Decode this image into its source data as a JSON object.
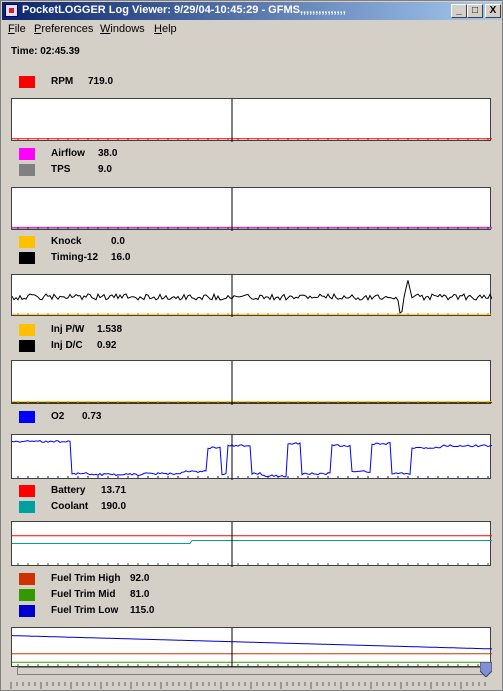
{
  "window": {
    "title": "PocketLOGGER Log Viewer: 9/29/04-10:45:29 - GFMS,,,,,,,,,,,,,,,",
    "minimize": "_",
    "maximize": "□",
    "close": "X"
  },
  "menu": [
    {
      "first": "F",
      "rest": "ile"
    },
    {
      "first": "P",
      "rest": "references"
    },
    {
      "first": "W",
      "rest": "indows"
    },
    {
      "first": "H",
      "rest": "elp"
    }
  ],
  "time": "Time: 02:45.39",
  "groups": [
    {
      "channels": [
        {
          "name": "RPM",
          "value": "719.0",
          "color": "#ff0000"
        }
      ],
      "traces": [
        {
          "color": "#ff0000",
          "shape": "flat",
          "level": 0.97
        }
      ],
      "tickColor": "#ff0000"
    },
    {
      "channels": [
        {
          "name": "Airflow",
          "value": "38.0",
          "color": "#ff00ff"
        },
        {
          "name": "TPS",
          "value": "9.0",
          "color": "#808080"
        }
      ],
      "traces": [
        {
          "color": "#ff00ff",
          "shape": "flat",
          "level": 0.96
        },
        {
          "color": "#808080",
          "shape": "flat",
          "level": 0.98
        }
      ],
      "tickColor": "#800080"
    },
    {
      "channels": [
        {
          "name": "Knock",
          "value": "0.0",
          "color": "#ffc000"
        },
        {
          "name": "Timing-12",
          "value": "16.0",
          "color": "#000000"
        }
      ],
      "traces": [
        {
          "color": "#000000",
          "shape": "noisy",
          "level": 0.55
        },
        {
          "color": "#ffc000",
          "shape": "flat",
          "level": 0.98
        }
      ],
      "tickColor": "#c0a000"
    },
    {
      "channels": [
        {
          "name": "Inj P/W",
          "value": "1.538",
          "color": "#ffc000"
        },
        {
          "name": "Inj D/C",
          "value": "0.92",
          "color": "#000000"
        }
      ],
      "traces": [
        {
          "color": "#000000",
          "shape": "flat",
          "level": 0.99
        },
        {
          "color": "#ffc000",
          "shape": "flat",
          "level": 0.97
        }
      ],
      "tickColor": "#c0a000"
    },
    {
      "channels": [
        {
          "name": "O2",
          "value": "0.73",
          "color": "#0000ff"
        }
      ],
      "traces": [
        {
          "color": "#0000ff",
          "shape": "o2",
          "level": 0.2
        }
      ],
      "tickColor": "#0000ff"
    },
    {
      "channels": [
        {
          "name": "Battery",
          "value": "13.71",
          "color": "#ff0000"
        },
        {
          "name": "Coolant",
          "value": "190.0",
          "color": "#00a0a0"
        }
      ],
      "traces": [
        {
          "color": "#ff0000",
          "shape": "flat",
          "level": 0.32
        },
        {
          "color": "#00a0a0",
          "shape": "step",
          "level": 0.45
        }
      ],
      "tickColor": "#008000"
    },
    {
      "channels": [
        {
          "name": "Fuel Trim High",
          "value": "92.0",
          "color": "#cc3300"
        },
        {
          "name": "Fuel Trim Mid",
          "value": "81.0",
          "color": "#339900"
        },
        {
          "name": "Fuel Trim Low",
          "value": "115.0",
          "color": "#0000cc"
        }
      ],
      "traces": [
        {
          "color": "#0000cc",
          "shape": "slope",
          "level": 0.25
        },
        {
          "color": "#cc3300",
          "shape": "flat",
          "level": 0.68
        },
        {
          "color": "#339900",
          "shape": "flat",
          "level": 0.9
        }
      ],
      "tickColor": "#008000"
    }
  ]
}
